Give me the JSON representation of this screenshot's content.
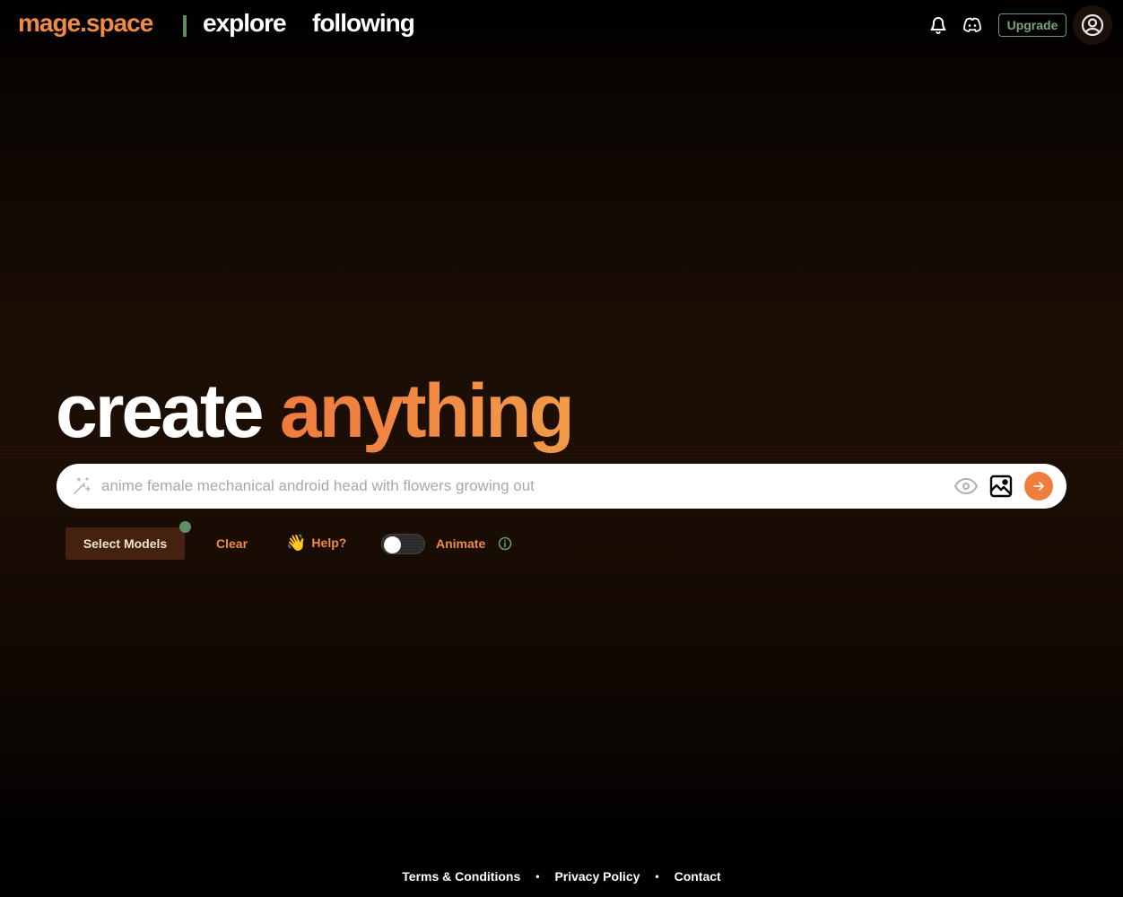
{
  "header": {
    "brand": "mage.space",
    "nav": [
      {
        "label": "explore"
      },
      {
        "label": "following"
      }
    ],
    "icons": {
      "notifications": "bell-icon",
      "discord": "discord-icon",
      "profile": "user-circle-icon"
    },
    "upgrade_label": "Upgrade"
  },
  "hero": {
    "word1": "create",
    "word2": "anything"
  },
  "prompt": {
    "value": "",
    "placeholder": "anime female mechanical android head with flowers growing out",
    "icons": {
      "left": "magic-wand-icon",
      "visibility": "eye-icon",
      "image": "image-upload-icon",
      "submit": "arrow-right-icon"
    }
  },
  "controls": {
    "select_models_label": "Select Models",
    "clear_label": "Clear",
    "help_emoji": "👋",
    "help_label": "Help?",
    "animate_label": "Animate",
    "animate_enabled": false
  },
  "footer": {
    "links": [
      {
        "label": "Terms & Conditions"
      },
      {
        "label": "Privacy Policy"
      },
      {
        "label": "Contact"
      }
    ],
    "separator": "•"
  },
  "colors": {
    "accent": "#f08a48",
    "green": "#6a9a70",
    "background": "#1a0d04"
  }
}
